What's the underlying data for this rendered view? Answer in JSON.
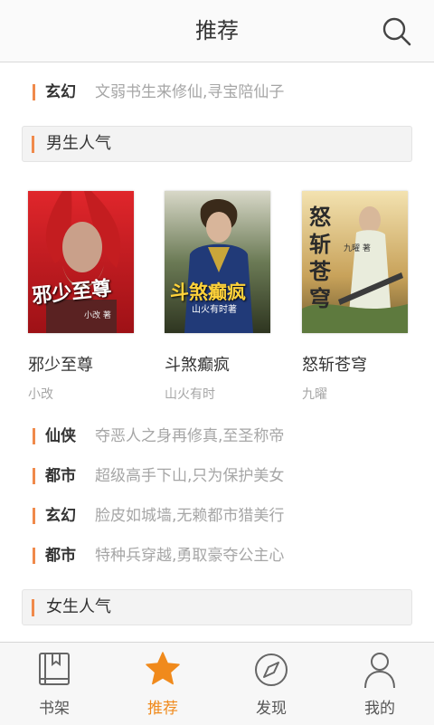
{
  "header": {
    "title": "推荐"
  },
  "topics_top": [
    {
      "category": "玄幻",
      "description": "文弱书生来修仙,寻宝陪仙子"
    }
  ],
  "sections": {
    "male": {
      "title": "男生人气"
    },
    "female": {
      "title": "女生人气"
    }
  },
  "books": [
    {
      "title": "邪少至尊",
      "author": "小改",
      "cover_text": "邪少至尊",
      "cover_sub": "小改 著"
    },
    {
      "title": "斗煞癫疯",
      "author": "山火有时",
      "cover_text": "斗煞癫疯",
      "cover_sub": "山火有时著"
    },
    {
      "title": "怒斩苍穹",
      "author": "九曜",
      "cover_text": "怒斩苍穹",
      "cover_sub": "九曜 著"
    }
  ],
  "topics_bottom": [
    {
      "category": "仙侠",
      "description": "夺恶人之身再修真,至圣称帝"
    },
    {
      "category": "都市",
      "description": "超级高手下山,只为保护美女"
    },
    {
      "category": "玄幻",
      "description": "脸皮如城墙,无赖都市猎美行"
    },
    {
      "category": "都市",
      "description": "特种兵穿越,勇取豪夺公主心"
    }
  ],
  "tabs": [
    {
      "label": "书架",
      "icon": "bookshelf-icon"
    },
    {
      "label": "推荐",
      "icon": "star-icon",
      "active": true
    },
    {
      "label": "发现",
      "icon": "compass-icon"
    },
    {
      "label": "我的",
      "icon": "person-icon"
    }
  ],
  "colors": {
    "accent": "#f08a4b",
    "active_tab": "#f08a1c"
  }
}
